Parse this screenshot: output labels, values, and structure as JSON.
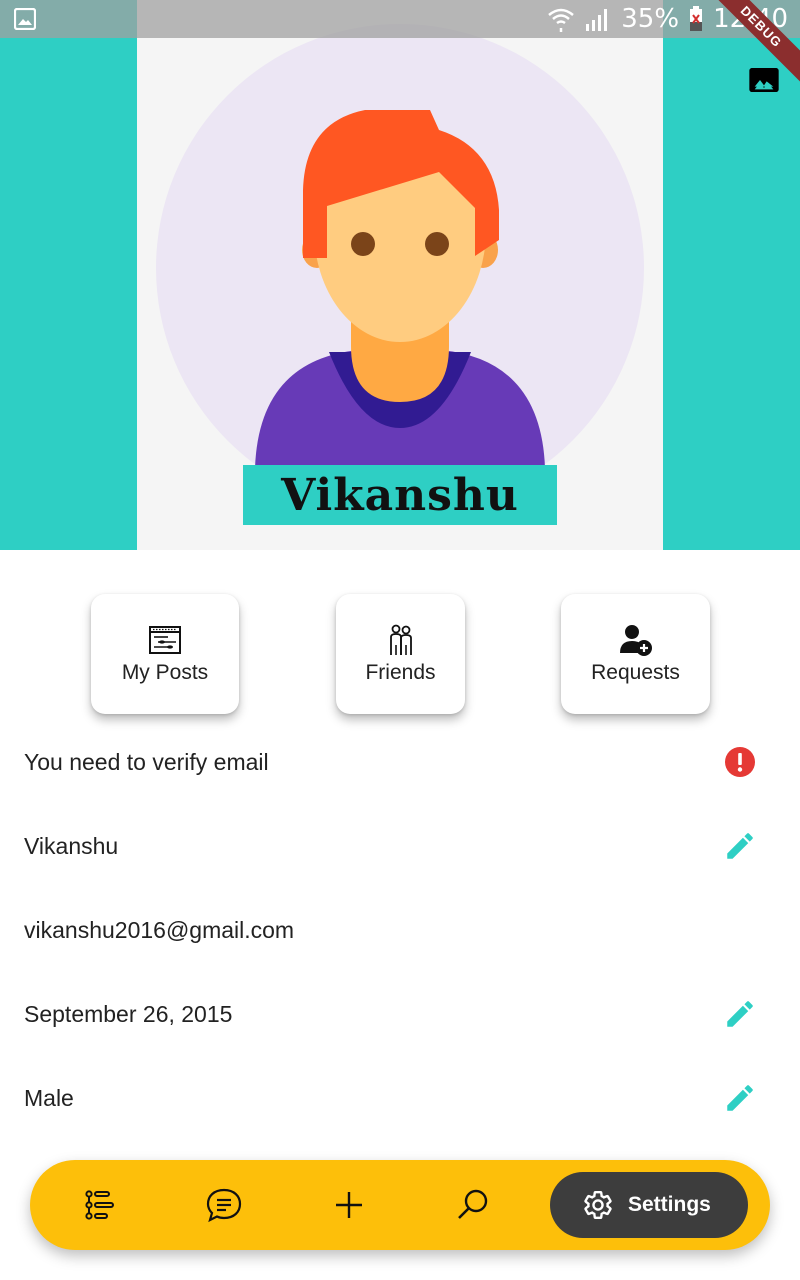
{
  "status_bar": {
    "battery": "35%",
    "time": "12:40",
    "debug_label": "DEBUG"
  },
  "profile": {
    "display_name": "Vikanshu"
  },
  "actions": [
    {
      "label": "My Posts",
      "icon": "posts-icon"
    },
    {
      "label": "Friends",
      "icon": "friends-icon"
    },
    {
      "label": "Requests",
      "icon": "add-person-icon"
    }
  ],
  "info": {
    "verify_message": "You need to verify email",
    "name": "Vikanshu",
    "email": "vikanshu2016@gmail.com",
    "birthday": "September 26, 2015",
    "gender": "Male"
  },
  "bottom_nav": {
    "items": [
      "list-icon",
      "chat-icon",
      "add-icon",
      "search-icon"
    ],
    "active_label": "Settings"
  },
  "colors": {
    "accent": "#2ecfc4",
    "nav_bar": "#fdbf0a",
    "nav_active": "#3d3d3d",
    "error": "#e53935"
  }
}
